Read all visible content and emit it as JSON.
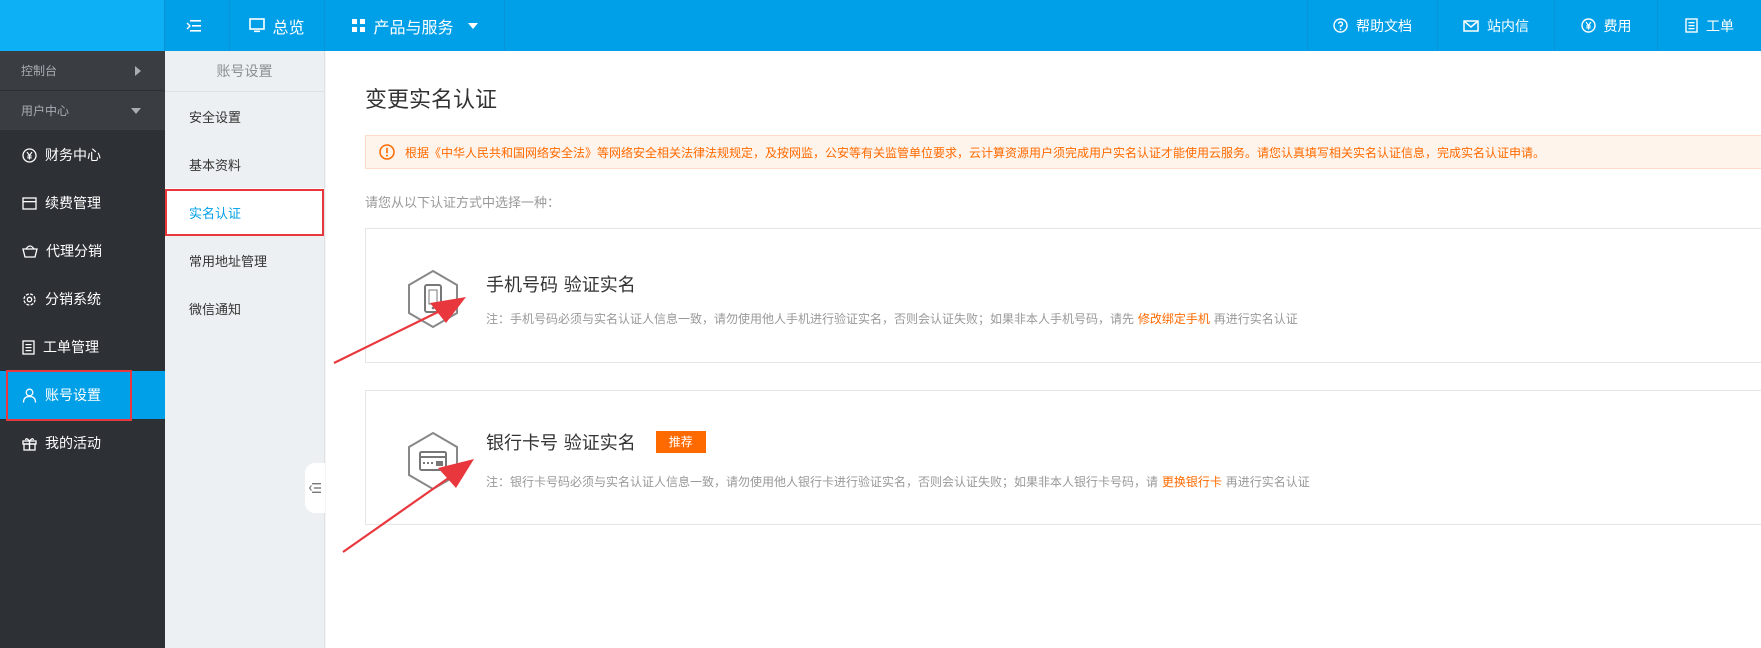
{
  "topbar": {
    "overview": "总览",
    "products": "产品与服务",
    "help": "帮助文档",
    "messages": "站内信",
    "fees": "费用",
    "tickets": "工单"
  },
  "sidebar": {
    "groups": [
      {
        "label": "控制台"
      },
      {
        "label": "用户中心"
      }
    ],
    "items": [
      {
        "label": "财务中心"
      },
      {
        "label": "续费管理"
      },
      {
        "label": "代理分销"
      },
      {
        "label": "分销系统"
      },
      {
        "label": "工单管理"
      },
      {
        "label": "账号设置"
      },
      {
        "label": "我的活动"
      }
    ]
  },
  "subnav": {
    "title": "账号设置",
    "items": [
      {
        "label": "安全设置"
      },
      {
        "label": "基本资料"
      },
      {
        "label": "实名认证"
      },
      {
        "label": "常用地址管理"
      },
      {
        "label": "微信通知"
      }
    ]
  },
  "main": {
    "title": "变更实名认证",
    "notice": "根据《中华人民共和国网络安全法》等网络安全相关法律法规规定，及按网监，公安等有关监管单位要求，云计算资源用户须完成用户实名认证才能使用云服务。请您认真填写相关实名认证信息，完成实名认证申请。",
    "choose_hint": "请您从以下认证方式中选择一种：",
    "phone_card": {
      "title": "手机号码 验证实名",
      "note_before": "注：手机号码必须与实名认证人信息一致，请勿使用他人手机进行验证实名，否则会认证失败；如果非本人手机号码，请先",
      "link": "修改绑定手机",
      "note_after": "再进行实名认证"
    },
    "bank_card": {
      "title": "银行卡号 验证实名",
      "badge": "推荐",
      "note_before": "注：银行卡号码必须与实名认证人信息一致，请勿使用他人银行卡进行验证实名，否则会认证失败；如果非本人银行卡号码，请",
      "link": "更换银行卡",
      "note_after": "再进行实名认证"
    }
  },
  "colors": {
    "primary": "#00a0e9",
    "sidebar_bg": "#2d3035",
    "accent": "#ff6a00",
    "annotation": "#e8383d"
  }
}
